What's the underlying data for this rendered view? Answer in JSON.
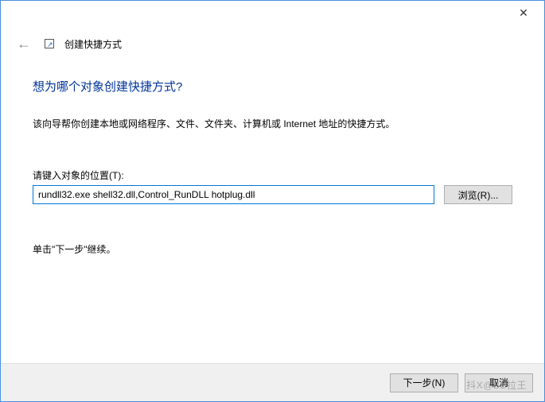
{
  "window": {
    "close_glyph": "✕"
  },
  "header": {
    "back_arrow": "←",
    "title": "创建快捷方式"
  },
  "main": {
    "heading": "想为哪个对象创建快捷方式?",
    "description": "该向导帮你创建本地或网络程序、文件、文件夹、计算机或 Internet 地址的快捷方式。",
    "field_label": "请键入对象的位置(T):",
    "path_value": "rundll32.exe shell32.dll,Control_RunDLL hotplug.dll",
    "browse_label": "浏览(R)...",
    "continue_text": "单击\"下一步\"继续。"
  },
  "footer": {
    "next_label": "下一步(N)",
    "cancel_label": "取消"
  },
  "watermark": "抖X@BB拉王"
}
